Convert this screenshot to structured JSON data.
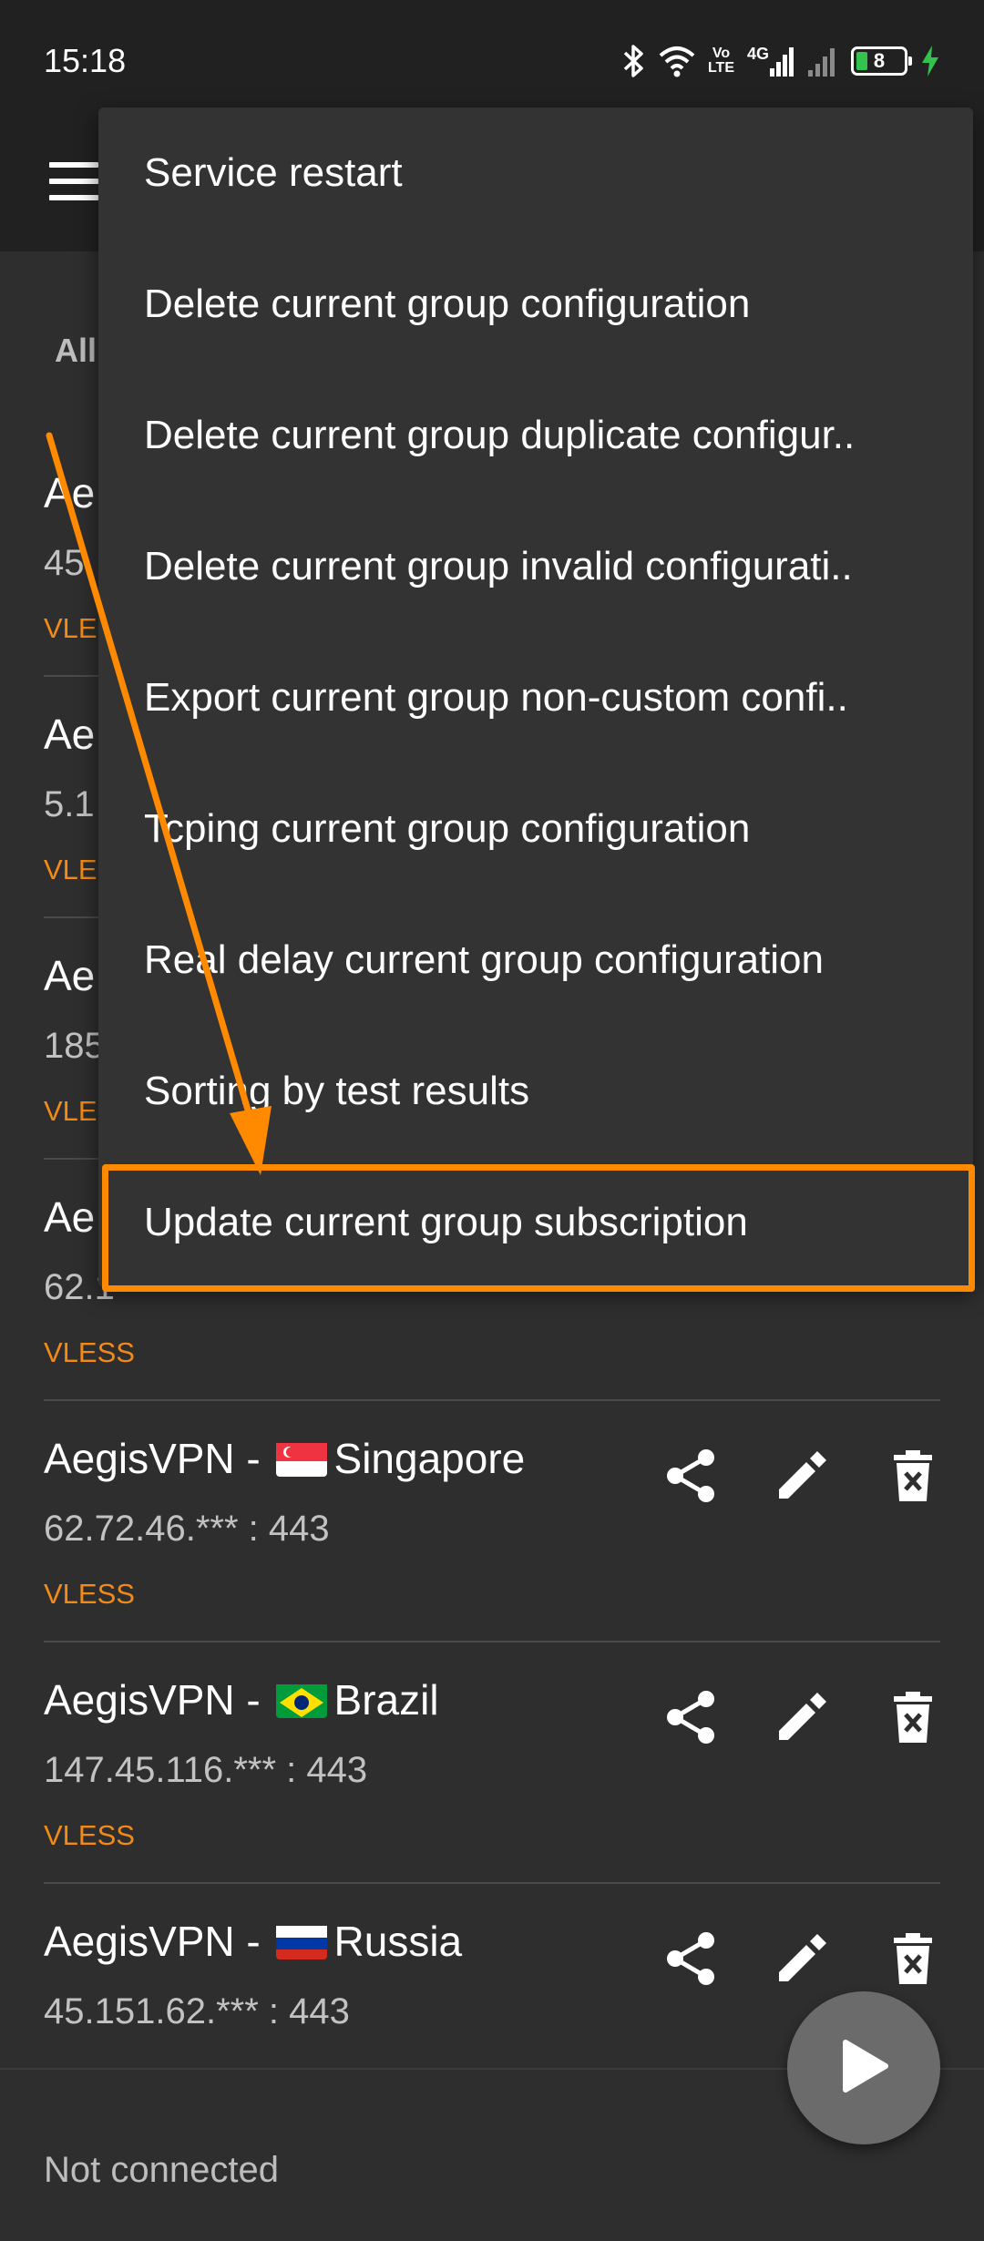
{
  "status_bar": {
    "time": "15:18",
    "network_lte": "Vo\nLTE",
    "network_type": "4G",
    "battery_level": "8"
  },
  "tabs": {
    "first_label": "All"
  },
  "servers": [
    {
      "name": "Ae",
      "address": "45",
      "protocol": "VLE"
    },
    {
      "name": "Ae",
      "address": "5.1",
      "protocol": "VLE"
    },
    {
      "name": "Ae",
      "address": "185",
      "protocol": "VLE"
    },
    {
      "name": "Ae",
      "address": "62.1",
      "protocol": "VLESS"
    },
    {
      "name_prefix": "AegisVPN - ",
      "country": "Singapore",
      "address": "62.72.46.*** : 443",
      "protocol": "VLESS"
    },
    {
      "name_prefix": "AegisVPN - ",
      "country": "Brazil",
      "address": "147.45.116.*** : 443",
      "protocol": "VLESS"
    },
    {
      "name_prefix": "AegisVPN - ",
      "country": "Russia",
      "address": "45.151.62.*** : 443",
      "protocol": ""
    }
  ],
  "overflow_menu": {
    "items": [
      "Service restart",
      "Delete current group configuration",
      "Delete current group duplicate configur..",
      "Delete current group invalid configurati..",
      "Export current group non-custom confi..",
      "Tcping current group configuration",
      "Real delay current group configuration",
      "Sorting by test results",
      "Update current group subscription"
    ],
    "highlighted_index": 8
  },
  "bottom": {
    "connection_status": "Not connected"
  },
  "icons": {
    "menu": "hamburger-menu-icon",
    "share": "share-icon",
    "edit": "pencil-icon",
    "delete": "delete-icon",
    "play": "play-icon"
  },
  "colors": {
    "accent": "#f28a17",
    "annotation": "#ff8a00",
    "background": "#2e2e2e",
    "toolbar": "#212121"
  }
}
